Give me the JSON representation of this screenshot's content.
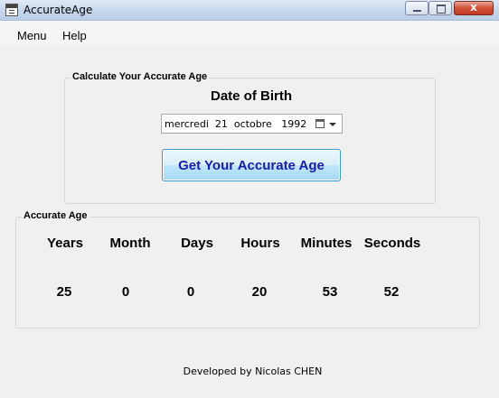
{
  "window": {
    "title": "AccurateAge",
    "close_label": "x"
  },
  "menu": {
    "items": [
      "Menu",
      "Help"
    ]
  },
  "calculate_group": {
    "legend": "Calculate Your Accurate Age",
    "dob_label": "Date of Birth",
    "date_value": "mercredi  21  octobre   1992",
    "button_label": "Get Your Accurate Age"
  },
  "accurate_age_group": {
    "legend": "Accurate Age",
    "columns": [
      {
        "header": "Years",
        "value": "25"
      },
      {
        "header": "Month",
        "value": "0"
      },
      {
        "header": "Days",
        "value": "0"
      },
      {
        "header": "Hours",
        "value": "20"
      },
      {
        "header": "Minutes",
        "value": "53"
      },
      {
        "header": "Seconds",
        "value": "52"
      }
    ]
  },
  "footer": {
    "text": "Developed by Nicolas CHEN"
  },
  "colors": {
    "button_text": "#1b1bb0",
    "button_border": "#3c9bd0",
    "close_button": "#c23a22"
  },
  "icons": [
    "app-icon",
    "minimize-icon",
    "maximize-icon",
    "close-icon",
    "calendar-icon",
    "chevron-down-icon"
  ]
}
